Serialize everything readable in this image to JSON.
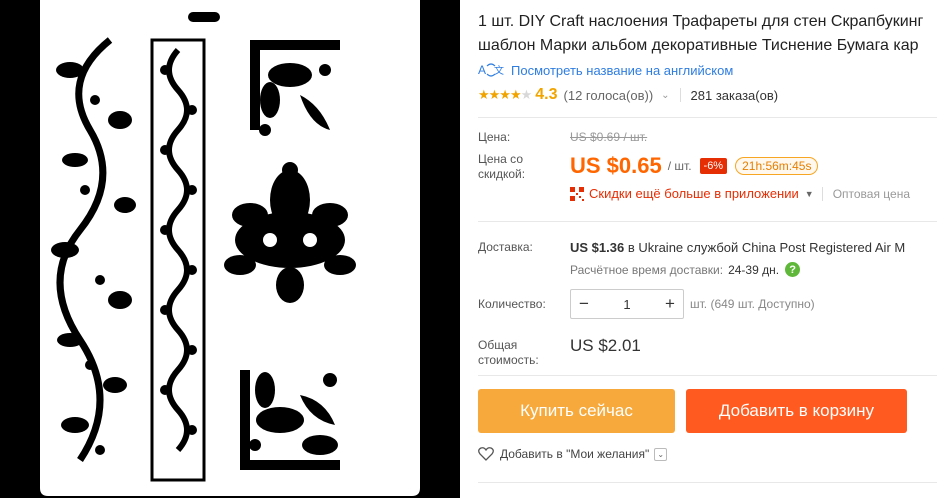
{
  "product": {
    "title_line1": "1 шт. DIY Craft наслоения Трафареты для стен Скрапбукинг",
    "title_line2": "шаблон Марки альбом декоративные Тиснение Бумага кар",
    "translate_link": "Посмотреть название на английском",
    "translate_icon": "translate-icon"
  },
  "rating": {
    "stars": "★★★★",
    "half_star": "★",
    "value": "4.3",
    "votes": "(12 голоса(ов))",
    "orders": "281 заказа(ов)"
  },
  "price": {
    "label": "Цена:",
    "old": "US $0.69 / шт.",
    "discount_label": "Цена со скидкой:",
    "current": "US $0.65",
    "unit": "/ шт.",
    "discount": "-6%",
    "timer": "21h:56m:45s",
    "app_text": "Скидки ещё больше в приложении",
    "bulk": "Оптовая цена"
  },
  "shipping": {
    "label": "Доставка:",
    "cost": "US $1.36",
    "in_word": "в",
    "country": "Ukraine",
    "by_word": "службой",
    "service": "China Post Registered Air M",
    "est_label": "Расчётное время доставки:",
    "est_days": "24-39 дн.",
    "help": "?"
  },
  "quantity": {
    "label": "Количество:",
    "minus": "−",
    "value": "1",
    "plus": "+",
    "note": "шт. (649 шт. Доступно)"
  },
  "total": {
    "label": "Общая стоимость:",
    "value": "US $2.01"
  },
  "actions": {
    "buy_now": "Купить сейчас",
    "add_to_cart": "Добавить в корзину",
    "wishlist": "Добавить в \"Мои желания\"",
    "wishlist_dropdown": "⌄"
  },
  "colors": {
    "price": "#ff6600",
    "buy_button": "#f7a93b",
    "cart_button": "#ff5a1f",
    "link": "#2e7de1",
    "discount_badge": "#e62e04"
  }
}
